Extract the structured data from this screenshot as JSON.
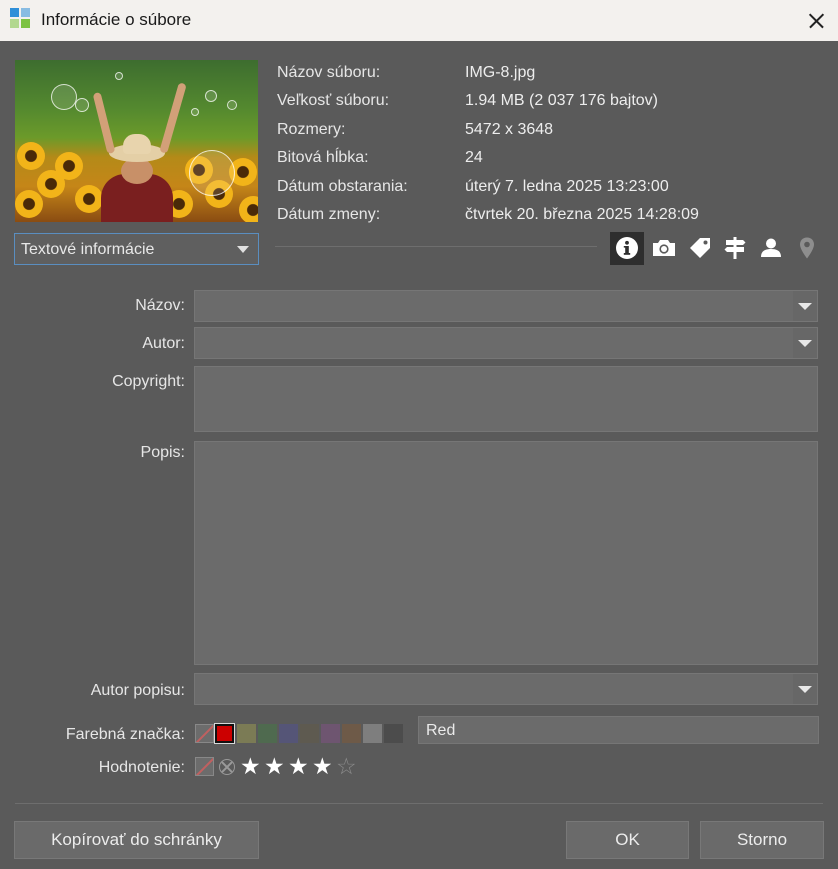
{
  "window": {
    "title": "Informácie o súbore"
  },
  "file_info": [
    {
      "label": "Názov súboru:",
      "value": "IMG-8.jpg"
    },
    {
      "label": "Veľkosť súboru:",
      "value": "1.94 MB (2 037 176 bajtov)"
    },
    {
      "label": "Rozmery:",
      "value": "5472 x 3648"
    },
    {
      "label": "Bitová hĺbka:",
      "value": "24"
    },
    {
      "label": "Dátum obstarania:",
      "value": "úterý 7. ledna 2025 13:23:00"
    },
    {
      "label": "Dátum zmeny:",
      "value": "čtvrtek 20. března 2025 14:28:09"
    }
  ],
  "view_selector": {
    "selected": "Textové informácie"
  },
  "tabs": [
    {
      "name": "info-icon",
      "active": true
    },
    {
      "name": "camera-icon",
      "active": false
    },
    {
      "name": "tag-icon",
      "active": false
    },
    {
      "name": "signpost-icon",
      "active": false
    },
    {
      "name": "person-icon",
      "active": false
    },
    {
      "name": "location-pin-icon",
      "active": false
    }
  ],
  "fields": {
    "title_label": "Názov:",
    "title_value": "",
    "author_label": "Autor:",
    "author_value": "",
    "copyright_label": "Copyright:",
    "copyright_value": "",
    "description_label": "Popis:",
    "description_value": "",
    "description_author_label": "Autor popisu:",
    "description_author_value": "",
    "color_label_label": "Farebná značka:",
    "color_label_value": "Red",
    "rating_label": "Hodnotenie:"
  },
  "color_swatches": [
    "none",
    "#cc0000",
    "#7b7b55",
    "#4f6a4f",
    "#555577",
    "#5e5a50",
    "#6e5570",
    "#6e5a48",
    "#7e7e7e",
    "#4c4c4c"
  ],
  "selected_color": "#cc0000",
  "rating": {
    "value": 4,
    "max": 5
  },
  "buttons": {
    "copy": "Kopírovať do schránky",
    "ok": "OK",
    "cancel": "Storno"
  }
}
